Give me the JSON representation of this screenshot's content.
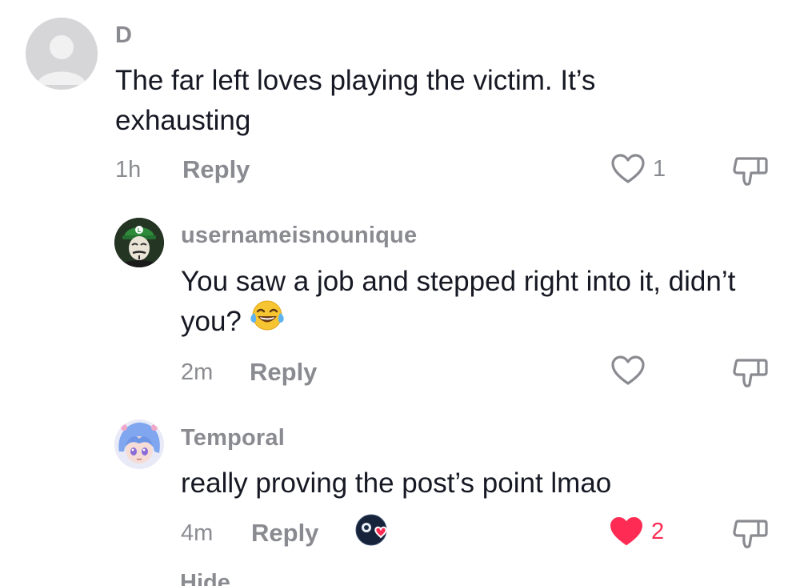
{
  "comments": [
    {
      "username": "D",
      "text": "The far left loves playing the victim. It’s exhausting",
      "time": "1h",
      "reply_label": "Reply",
      "likes": "1",
      "liked": false
    },
    {
      "username": "usernameisnounique",
      "text": "You saw a job and stepped right into it, didn’t you?",
      "emoji_icon": "face-with-tears-of-joy-icon",
      "time": "2m",
      "reply_label": "Reply",
      "likes": "",
      "liked": false
    },
    {
      "username": "Temporal",
      "text": "really proving the post’s point lmao",
      "time": "4m",
      "reply_label": "Reply",
      "likes": "2",
      "liked": true
    }
  ],
  "hide_label": "Hide",
  "colors": {
    "muted": "#8a8b91",
    "text": "#161823",
    "like_red": "#fe2c55"
  }
}
